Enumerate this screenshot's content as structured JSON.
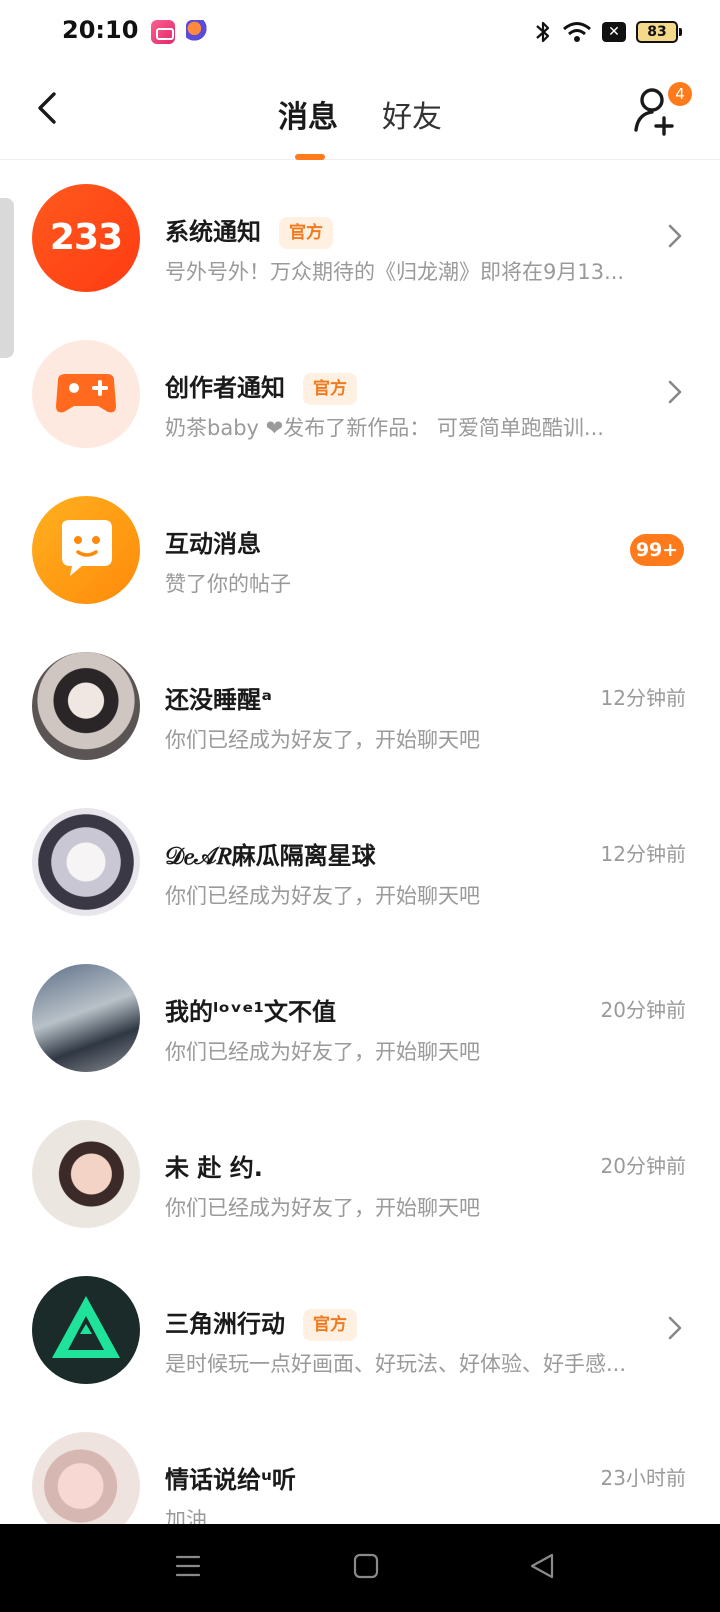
{
  "status_bar": {
    "time": "20:10",
    "battery": "83",
    "icons": [
      "bluetooth-icon",
      "wifi-icon",
      "close-box-icon",
      "battery-icon"
    ]
  },
  "header": {
    "tabs": [
      {
        "label": "消息",
        "active": true
      },
      {
        "label": "好友",
        "active": false
      }
    ],
    "add_friend_badge": "4"
  },
  "messages": [
    {
      "avatar_text": "233",
      "title": "系统通知",
      "official_label": "官方",
      "subtitle": "号外号外！万众期待的《归龙潮》即将在9月13...",
      "time": "",
      "badge": "",
      "chevron": true
    },
    {
      "avatar_text": "",
      "title": "创作者通知",
      "official_label": "官方",
      "subtitle": "奶茶baby ❤发布了新作品：  可爱简单跑酷训...",
      "time": "",
      "badge": "",
      "chevron": true
    },
    {
      "avatar_text": "",
      "title": "互动消息",
      "official_label": "",
      "subtitle": "赞了你的帖子",
      "time": "",
      "badge": "99+",
      "chevron": false
    },
    {
      "avatar_text": "",
      "title": "还没睡醒ᵃ",
      "official_label": "",
      "subtitle": "你们已经成为好友了，开始聊天吧",
      "time": "12分钟前",
      "badge": "",
      "chevron": false
    },
    {
      "avatar_text": "",
      "title": "𝒟𝑒𝒜𝑅麻瓜隔离星球",
      "official_label": "",
      "subtitle": "你们已经成为好友了，开始聊天吧",
      "time": "12分钟前",
      "badge": "",
      "chevron": false
    },
    {
      "avatar_text": "",
      "title": "我的ˡᵒᵛᵉ¹文不值",
      "official_label": "",
      "subtitle": "你们已经成为好友了，开始聊天吧",
      "time": "20分钟前",
      "badge": "",
      "chevron": false
    },
    {
      "avatar_text": "",
      "title": "未 赴 约.",
      "official_label": "",
      "subtitle": "你们已经成为好友了，开始聊天吧",
      "time": "20分钟前",
      "badge": "",
      "chevron": false
    },
    {
      "avatar_text": "",
      "title": "三角洲行动",
      "official_label": "官方",
      "subtitle": "是时候玩一点好画面、好玩法、好体验、好手感...",
      "time": "",
      "badge": "",
      "chevron": true
    },
    {
      "avatar_text": "",
      "title": "情话说给ᵘ听",
      "official_label": "",
      "subtitle": "加油",
      "time": "23小时前",
      "badge": "",
      "chevron": false
    }
  ],
  "colors": {
    "accent": "#ff7a1a",
    "official_bg": "#fff0e2",
    "official_text": "#f17a1f",
    "subtitle": "#9a9a9a"
  }
}
